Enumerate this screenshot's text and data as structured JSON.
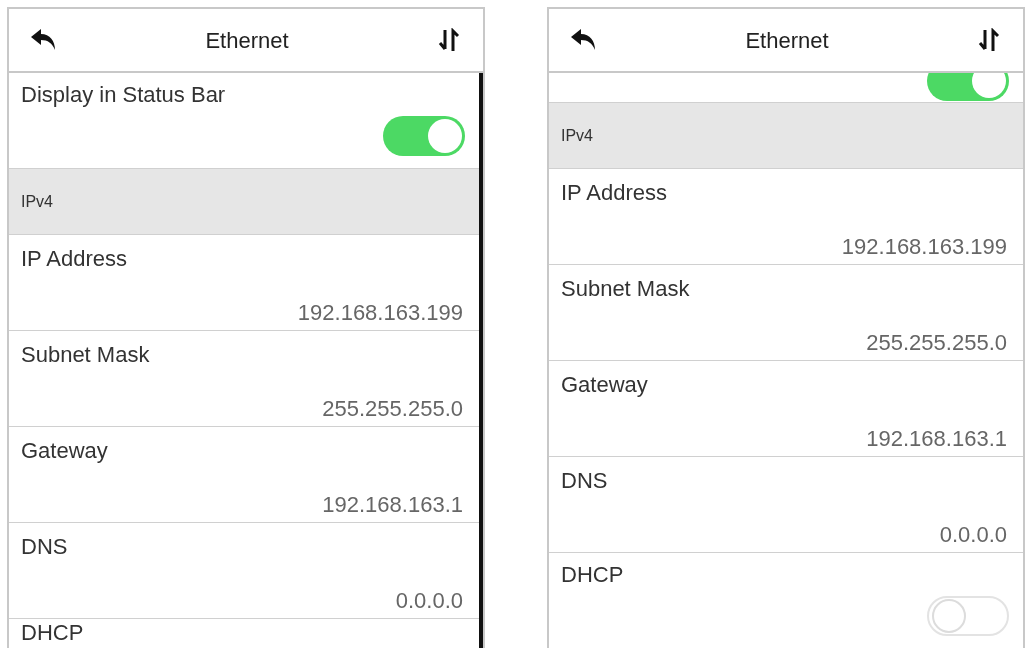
{
  "screens": [
    {
      "title": "Ethernet",
      "scrollbar_shown": true,
      "items": [
        {
          "kind": "toggle",
          "label": "Display in Status Bar",
          "on": true,
          "cropped": false
        },
        {
          "kind": "section",
          "label": "IPv4"
        },
        {
          "kind": "value",
          "label": "IP Address",
          "value": "192.168.163.199"
        },
        {
          "kind": "value",
          "label": "Subnet Mask",
          "value": "255.255.255.0"
        },
        {
          "kind": "value",
          "label": "Gateway",
          "value": "192.168.163.1"
        },
        {
          "kind": "value",
          "label": "DNS",
          "value": "0.0.0.0"
        },
        {
          "kind": "heading",
          "label": "DHCP"
        }
      ]
    },
    {
      "title": "Ethernet",
      "scrollbar_shown": false,
      "items": [
        {
          "kind": "toggle",
          "on": true,
          "cropped": true
        },
        {
          "kind": "section",
          "label": "IPv4"
        },
        {
          "kind": "value",
          "label": "IP Address",
          "value": "192.168.163.199"
        },
        {
          "kind": "value",
          "label": "Subnet Mask",
          "value": "255.255.255.0"
        },
        {
          "kind": "value",
          "label": "Gateway",
          "value": "192.168.163.1"
        },
        {
          "kind": "value",
          "label": "DNS",
          "value": "0.0.0.0"
        },
        {
          "kind": "toggle",
          "label": "DHCP",
          "on": false,
          "cropped": false
        }
      ]
    }
  ]
}
